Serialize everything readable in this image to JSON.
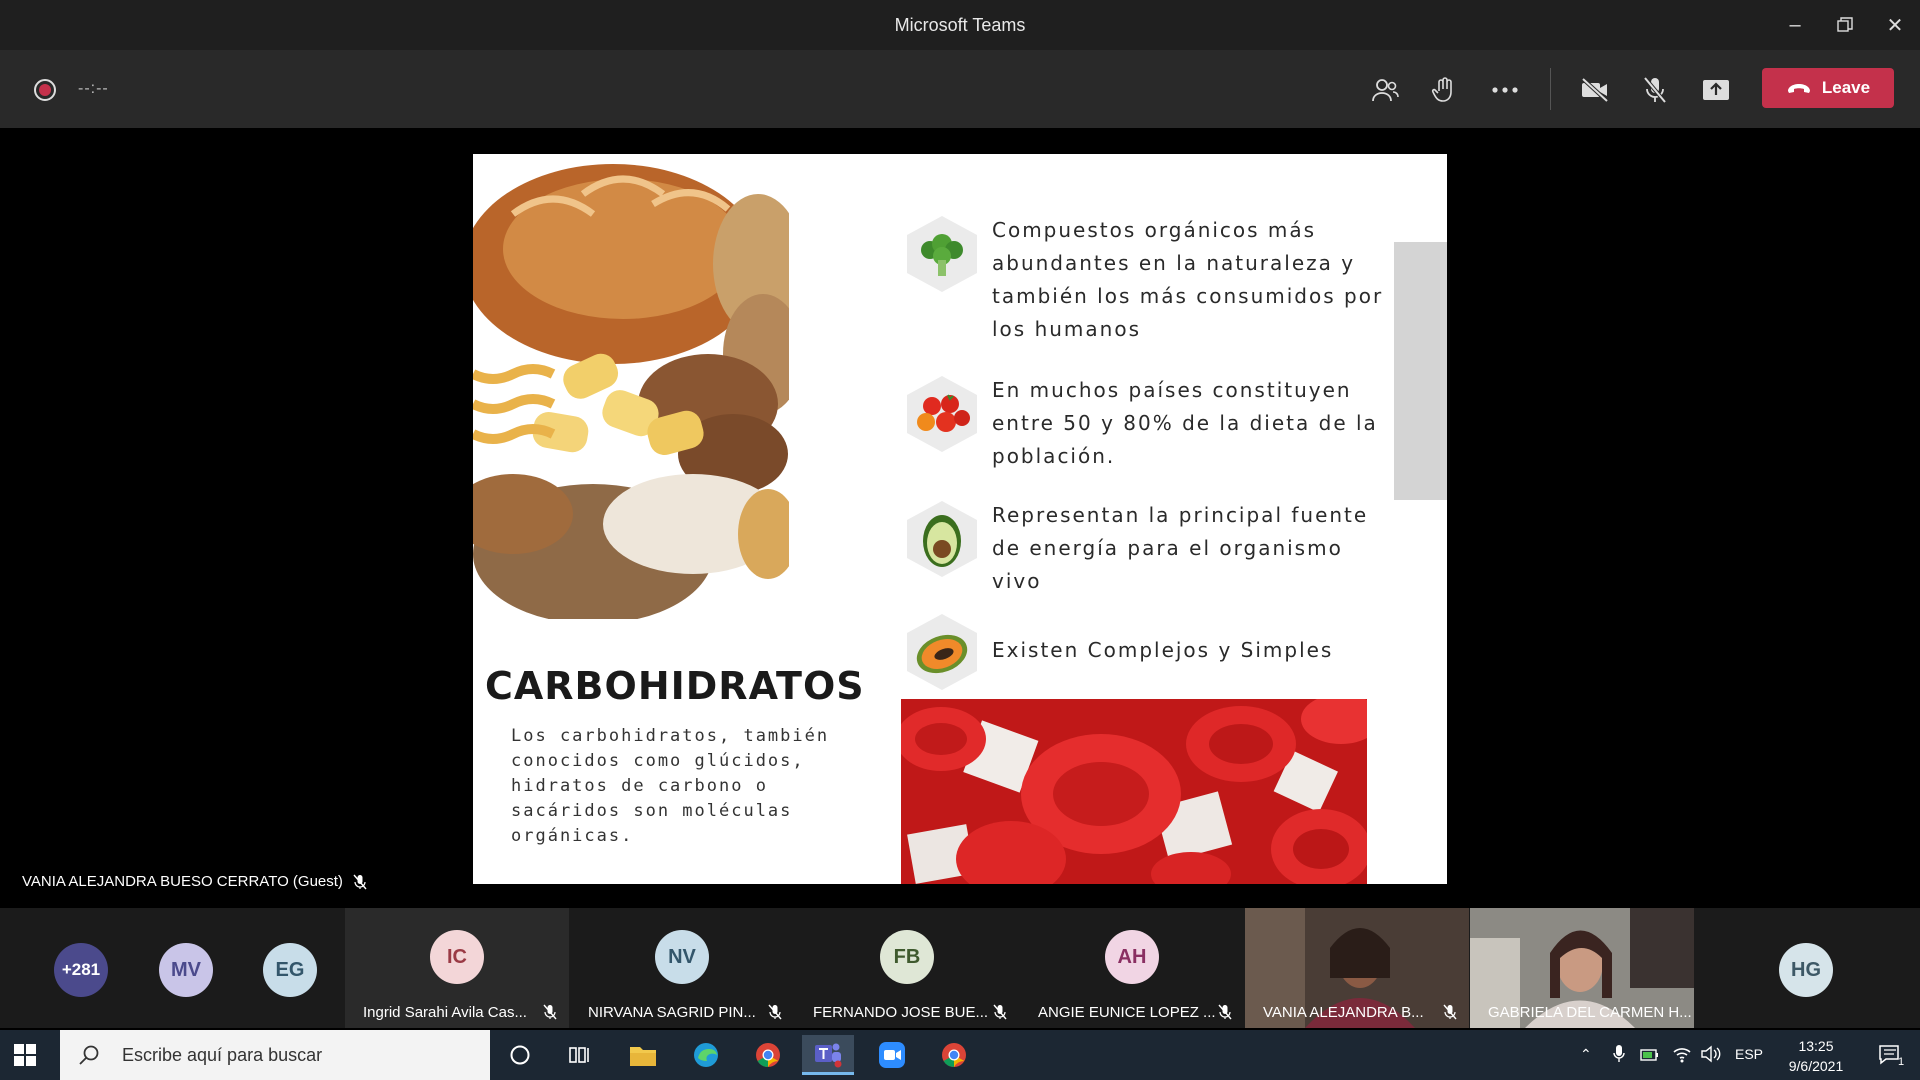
{
  "window": {
    "title": "Microsoft Teams"
  },
  "toolbar": {
    "timer": "--:--",
    "leave_label": "Leave"
  },
  "slide": {
    "title": "CARBOHIDRATOS",
    "description": "Los carbohidratos, también conocidos como glúcidos, hidratos de carbono o sacáridos son moléculas orgánicas.",
    "bullets": [
      {
        "icon": "broccoli-icon",
        "text": "Compuestos orgánicos más abundantes en la naturaleza y también los más consumidos por los humanos"
      },
      {
        "icon": "tomatoes-icon",
        "text": "En muchos países constituyen entre 50 y 80% de la dieta de la población."
      },
      {
        "icon": "avocado-icon",
        "text": "Representan la principal fuente de energía para el organismo vivo"
      },
      {
        "icon": "papaya-icon",
        "text": "Existen Complejos y Simples"
      }
    ]
  },
  "presenter": {
    "name": "VANIA ALEJANDRA BUESO CERRATO (Guest)"
  },
  "participants": {
    "overflow": "+281",
    "avatars": [
      {
        "initials": "MV",
        "color": "#c9c5e8"
      },
      {
        "initials": "EG",
        "color": "#c8dde9"
      },
      {
        "initials": "HG",
        "color": "#d6e4ea"
      }
    ],
    "tiles": [
      {
        "initials": "IC",
        "name": "Ingrid Sarahi Avila Cas...",
        "color": "#f3d6d8"
      },
      {
        "initials": "NV",
        "name": "NIRVANA SAGRID PIN...",
        "color": "#c8dde9"
      },
      {
        "initials": "FB",
        "name": "FERNANDO JOSE BUE...",
        "color": "#dfe7d6"
      },
      {
        "initials": "AH",
        "name": "ANGIE EUNICE LOPEZ ...",
        "color": "#f1d5e4"
      },
      {
        "initials": "",
        "name": "VANIA ALEJANDRA B...",
        "color": ""
      },
      {
        "initials": "",
        "name": "GABRIELA DEL CARMEN H...",
        "color": ""
      }
    ]
  },
  "taskbar": {
    "search_placeholder": "Escribe aquí para buscar",
    "language": "ESP",
    "time": "13:25",
    "date": "9/6/2021",
    "notifications": "1"
  }
}
